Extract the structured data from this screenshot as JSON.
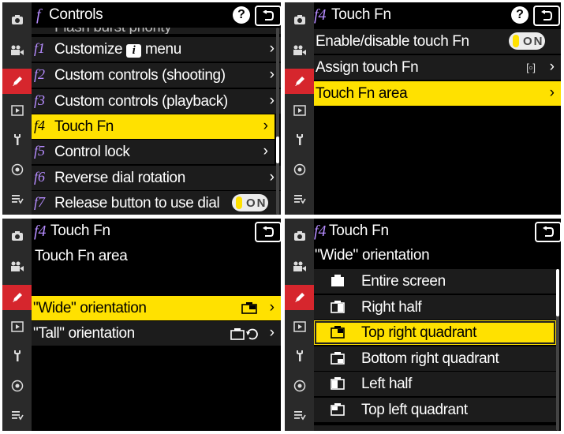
{
  "sidebar_icons": [
    "camera-icon",
    "movie-icon",
    "pencil-icon",
    "playback-icon",
    "wrench-icon",
    "network-icon",
    "my-menu-icon"
  ],
  "panel1": {
    "header_icon": "f",
    "header_title": "Controls",
    "partial_text": "Flash burst priority",
    "rows": [
      {
        "code": "f1",
        "label_pre": "Customize",
        "label_post": "menu",
        "selected": false
      },
      {
        "code": "f2",
        "label": "Custom controls (shooting)",
        "selected": false
      },
      {
        "code": "f3",
        "label": "Custom controls (playback)",
        "selected": false
      },
      {
        "code": "f4",
        "label": "Touch Fn",
        "selected": true
      },
      {
        "code": "f5",
        "label": "Control lock",
        "selected": false
      },
      {
        "code": "f6",
        "label": "Reverse dial rotation",
        "selected": false
      },
      {
        "code": "f7",
        "label": "Release button to use dial",
        "selected": false,
        "toggle": "ON"
      }
    ],
    "info_glyph": "i"
  },
  "panel2": {
    "header_icon": "f4",
    "header_title": "Touch Fn",
    "rows": [
      {
        "label": "Enable/disable touch Fn",
        "toggle": "ON",
        "selected": false
      },
      {
        "label": "Assign touch Fn",
        "value": "[▫]",
        "selected": false
      },
      {
        "label": "Touch Fn area",
        "selected": true
      }
    ]
  },
  "panel3": {
    "header_icon": "f4",
    "header_title": "Touch Fn",
    "subtitle": "Touch Fn area",
    "rows": [
      {
        "label": "\"Wide\" orientation",
        "selected": true
      },
      {
        "label": "\"Tall\" orientation",
        "selected": false
      }
    ]
  },
  "panel4": {
    "header_icon": "f4",
    "header_title": "Touch Fn",
    "subtitle": "\"Wide\" orientation",
    "options": [
      {
        "label": "Entire screen",
        "selected": false
      },
      {
        "label": "Right half",
        "selected": false
      },
      {
        "label": "Top right quadrant",
        "selected": true
      },
      {
        "label": "Bottom right quadrant",
        "selected": false
      },
      {
        "label": "Left half",
        "selected": false
      },
      {
        "label": "Top left quadrant",
        "selected": false
      }
    ]
  },
  "colors": {
    "accent_yellow": "#ffe100",
    "sidebar_active": "#d6262d",
    "menu_code": "#b68cff"
  }
}
